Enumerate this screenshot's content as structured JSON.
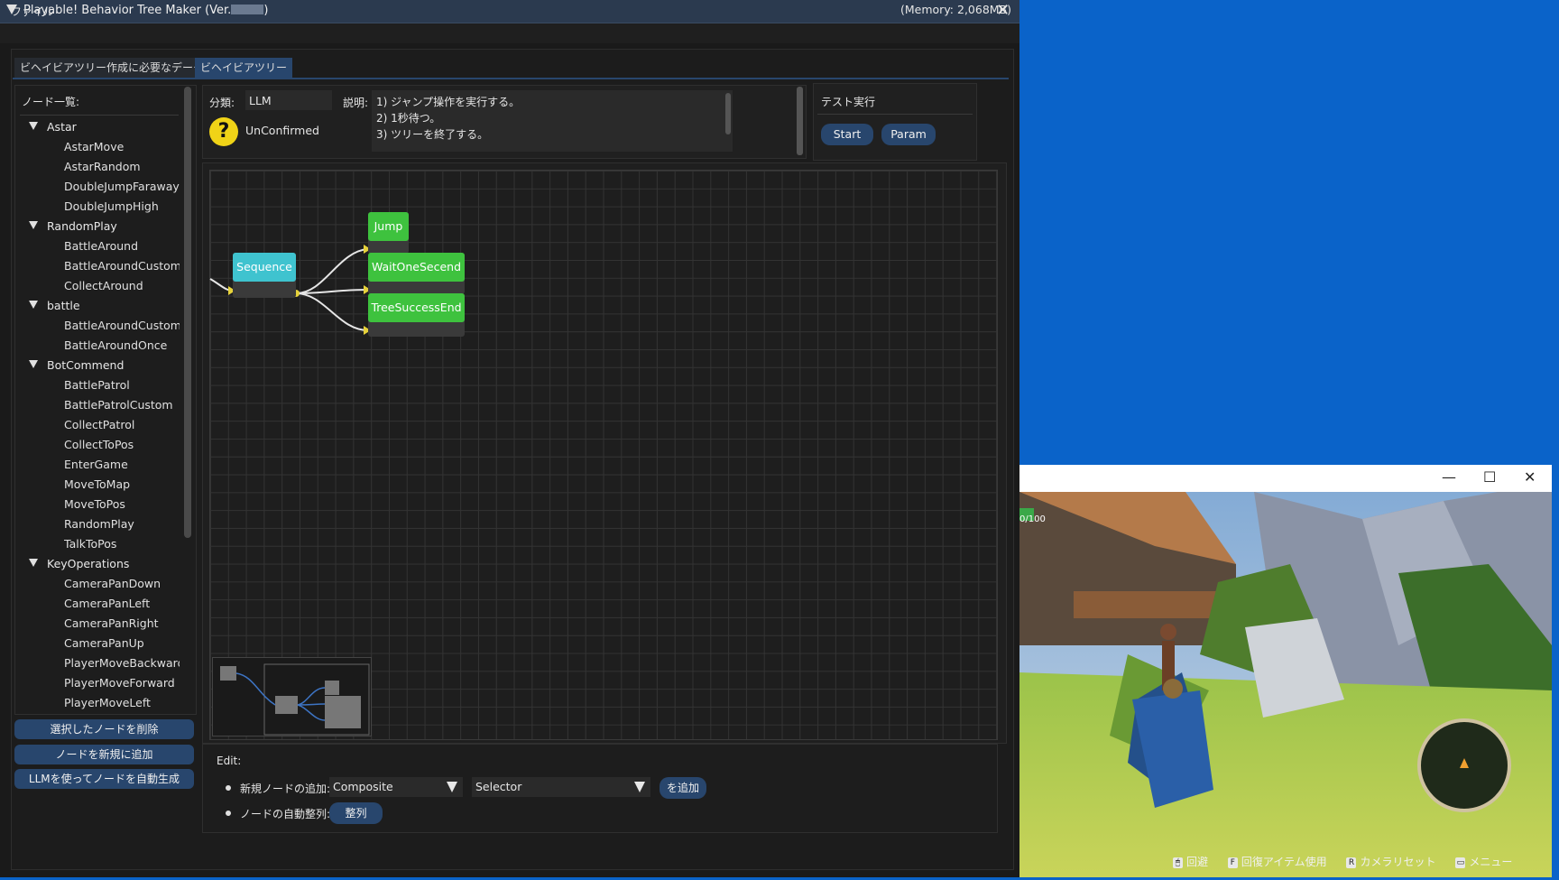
{
  "window": {
    "title": "Playable! Behavior Tree Maker (Ver.",
    "close_label": "✕"
  },
  "menu": {
    "file": "ファイル",
    "memory": "(Memory: 2,068MB)"
  },
  "tabs": [
    {
      "label": "ビヘイビアツリー作成に必要なデータ"
    },
    {
      "label": "ビヘイビアツリー"
    }
  ],
  "nodelist": {
    "title": "ノード一覧:",
    "categories": [
      {
        "name": "Astar",
        "items": [
          "AstarMove",
          "AstarRandom",
          "DoubleJumpFaraway",
          "DoubleJumpHigh"
        ]
      },
      {
        "name": "RandomPlay",
        "items": [
          "BattleAround",
          "BattleAroundCustom",
          "CollectAround"
        ]
      },
      {
        "name": "battle",
        "items": [
          "BattleAroundCustomC",
          "BattleAroundOnce"
        ]
      },
      {
        "name": "BotCommend",
        "items": [
          "BattlePatrol",
          "BattlePatrolCustom",
          "CollectPatrol",
          "CollectToPos",
          "EnterGame",
          "MoveToMap",
          "MoveToPos",
          "RandomPlay",
          "TalkToPos"
        ]
      },
      {
        "name": "KeyOperations",
        "items": [
          "CameraPanDown",
          "CameraPanLeft",
          "CameraPanRight",
          "CameraPanUp",
          "PlayerMoveBackward",
          "PlayerMoveForward",
          "PlayerMoveLeft"
        ]
      }
    ]
  },
  "sidebar_buttons": {
    "delete": "選択したノードを削除",
    "add": "ノードを新規に追加",
    "llm": "LLMを使ってノードを自動生成"
  },
  "info": {
    "category_label": "分類:",
    "category_value": "LLM",
    "desc_label": "説明:",
    "desc_lines": [
      "1) ジャンプ操作を実行する。",
      "2) 1秒待つ。",
      "3) ツリーを終了する。"
    ],
    "status_icon": "?",
    "status_text": "UnConfirmed"
  },
  "test": {
    "title": "テスト実行",
    "start": "Start",
    "param": "Param"
  },
  "tree": {
    "sequence": "Sequence",
    "jump": "Jump",
    "wait": "WaitOneSecend",
    "success": "TreeSuccessEnd"
  },
  "edit": {
    "title": "Edit:",
    "add_label": "新規ノードの追加:",
    "type_value": "Composite",
    "node_value": "Selector",
    "add_button": "を追加",
    "arrange_label": "ノードの自動整列:",
    "arrange_button": "整列"
  },
  "game": {
    "hp": "0/100",
    "hud": [
      {
        "key": "🖱",
        "label": "回避"
      },
      {
        "key": "F",
        "label": "回復アイテム使用"
      },
      {
        "key": "R",
        "label": "カメラリセット"
      },
      {
        "key": "▭",
        "label": "メニュー"
      }
    ]
  }
}
